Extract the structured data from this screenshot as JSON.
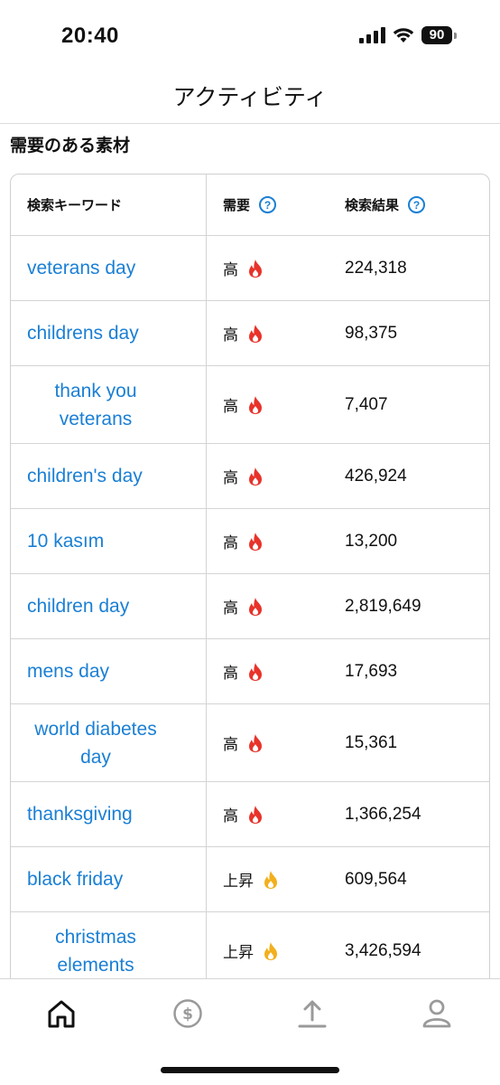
{
  "status": {
    "time": "20:40",
    "battery": "90"
  },
  "nav": {
    "title": "アクティビティ"
  },
  "section": {
    "title": "需要のある素材"
  },
  "table": {
    "headers": {
      "keyword": "検索キーワード",
      "demand": "需要",
      "results": "検索結果"
    },
    "rows": [
      {
        "keyword": "veterans day",
        "demand": "高",
        "level": "high",
        "results": "224,318",
        "wrap": false
      },
      {
        "keyword": "childrens day",
        "demand": "高",
        "level": "high",
        "results": "98,375",
        "wrap": false
      },
      {
        "keyword": "thank you veterans",
        "demand": "高",
        "level": "high",
        "results": "7,407",
        "wrap": true
      },
      {
        "keyword": "children's day",
        "demand": "高",
        "level": "high",
        "results": "426,924",
        "wrap": false
      },
      {
        "keyword": "10 kasım",
        "demand": "高",
        "level": "high",
        "results": "13,200",
        "wrap": false
      },
      {
        "keyword": "children day",
        "demand": "高",
        "level": "high",
        "results": "2,819,649",
        "wrap": false
      },
      {
        "keyword": "mens day",
        "demand": "高",
        "level": "high",
        "results": "17,693",
        "wrap": false
      },
      {
        "keyword": "world diabetes day",
        "demand": "高",
        "level": "high",
        "results": "15,361",
        "wrap": true
      },
      {
        "keyword": "thanksgiving",
        "demand": "高",
        "level": "high",
        "results": "1,366,254",
        "wrap": false
      },
      {
        "keyword": "black friday",
        "demand": "上昇",
        "level": "rising",
        "results": "609,564",
        "wrap": false
      },
      {
        "keyword": "christmas elements",
        "demand": "上昇",
        "level": "rising",
        "results": "3,426,594",
        "wrap": true
      }
    ]
  },
  "tabs": [
    {
      "icon": "home-icon",
      "active": true
    },
    {
      "icon": "dollar-icon",
      "active": false
    },
    {
      "icon": "upload-icon",
      "active": false
    },
    {
      "icon": "profile-icon",
      "active": false
    }
  ],
  "colors": {
    "link": "#1a7fd4",
    "flame_high": "#e8332a",
    "flame_rising": "#f2b01e",
    "tab_inactive": "#9a9a9a",
    "tab_active": "#111111"
  }
}
